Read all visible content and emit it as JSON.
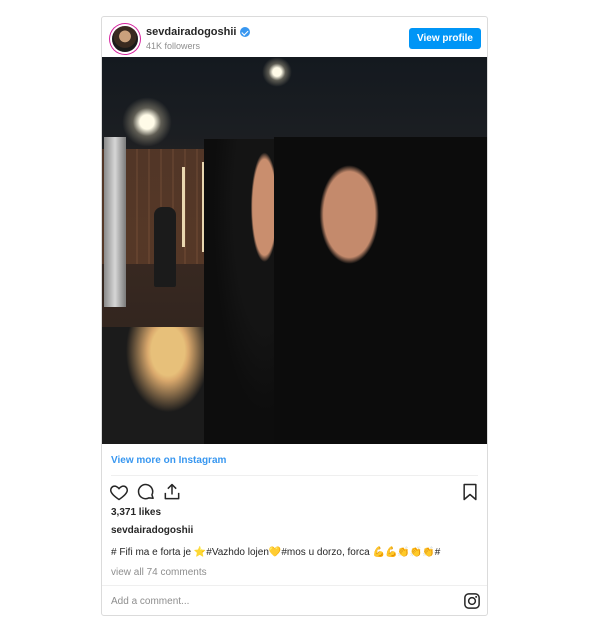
{
  "post": {
    "username": "sevdairadogoshii",
    "followers": "41K followers",
    "view_profile_label": "View profile",
    "view_more_label": "View more on Instagram",
    "likes": "3,371 likes",
    "caption_user": "sevdairadogoshii",
    "caption_text": "# Fifi ma e forta je ⭐#Vazhdo lojen💛#mos u dorzo, forca 💪💪👏👏👏#",
    "view_comments": "view all 74 comments",
    "add_comment_placeholder": "Add a comment..."
  },
  "icons": [
    "avatar",
    "verified-badge-icon",
    "heart-icon",
    "comment-icon",
    "share-icon",
    "bookmark-icon",
    "instagram-icon"
  ],
  "colors": {
    "accent": "#0095f6",
    "link": "#3897f0",
    "muted": "#8e8e8e",
    "text": "#262626"
  }
}
